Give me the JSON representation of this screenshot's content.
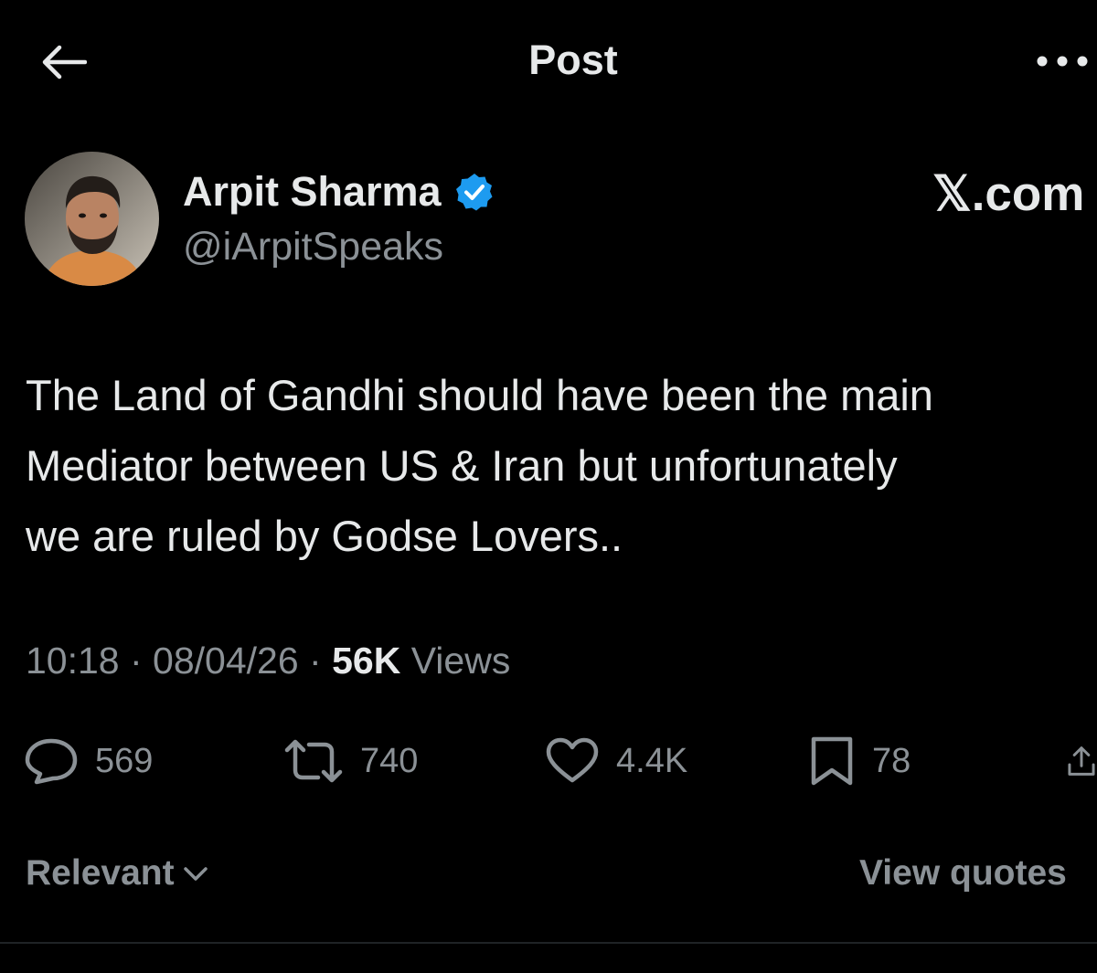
{
  "header": {
    "title": "Post"
  },
  "author": {
    "name": "Arpit Sharma",
    "handle": "@iArpitSpeaks",
    "verified": true
  },
  "watermark": "𝕏.com",
  "tweet": {
    "lines": [
      "The Land of Gandhi should have been the main",
      "Mediator between US & Iran but unfortunately",
      "we are ruled by Godse Lovers.."
    ]
  },
  "meta": {
    "time": "10:18",
    "sep1": " · ",
    "date": "08/04/26",
    "sep2": " · ",
    "views_count": "56K",
    "views_label": " Views"
  },
  "actions": {
    "replies": "569",
    "reposts": "740",
    "likes": "4.4K",
    "bookmarks": "78"
  },
  "bottom": {
    "sort_label": "Relevant",
    "view_quotes": "View quotes"
  },
  "colors": {
    "background": "#000000",
    "primary_text": "#e7e9ea",
    "secondary_text": "#8b9196",
    "verified_badge": "#1d9bf0"
  }
}
